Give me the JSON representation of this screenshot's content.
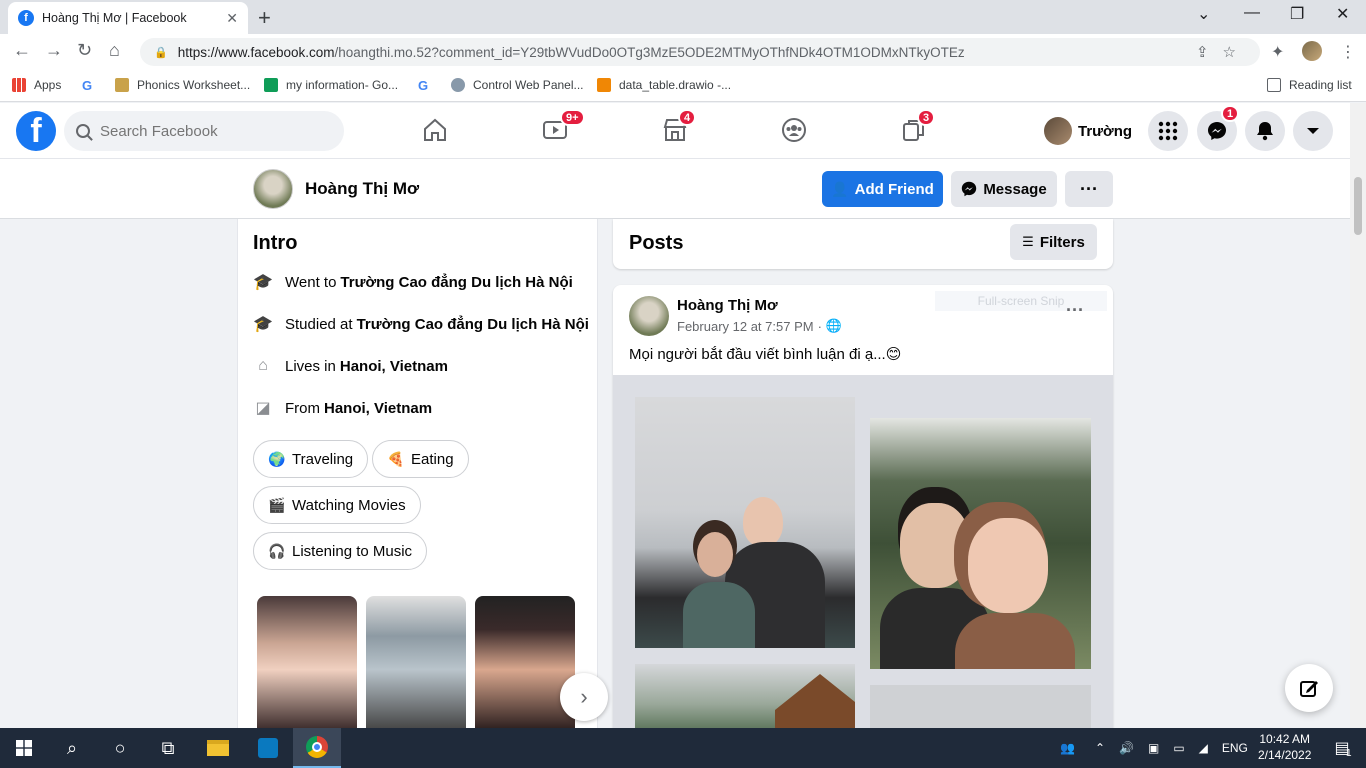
{
  "browser": {
    "tab_title": "Hoàng Thị Mơ | Facebook",
    "url_host": "https://www.facebook.com",
    "url_path": "/hoangthi.mo.52?comment_id=Y29tbWVudDo0OTg3MzE5ODE2MTMyOThfNDk4OTM1ODMxNTkyOTEz",
    "bookmarks": [
      {
        "label": "Apps"
      },
      {
        "label": ""
      },
      {
        "label": "Phonics Worksheet..."
      },
      {
        "label": "my information- Go..."
      },
      {
        "label": ""
      },
      {
        "label": "Control Web Panel..."
      },
      {
        "label": "data_table.drawio -..."
      }
    ],
    "reading_list": "Reading list"
  },
  "fb": {
    "search_placeholder": "Search Facebook",
    "watch_badge": "9+",
    "marketplace_badge": "4",
    "gaming_badge": "3",
    "user_name": "Trường",
    "messenger_badge": "1"
  },
  "profile": {
    "name": "Hoàng Thị Mơ",
    "add_friend": "Add Friend",
    "message": "Message",
    "more": "···"
  },
  "intro": {
    "title": "Intro",
    "rows": [
      {
        "prefix": "Went to",
        "value": "Trường Cao đẳng Du lịch Hà Nội",
        "icon": "graduation-cap-icon"
      },
      {
        "prefix": "Studied at",
        "value": "Trường Cao đẳng Du lịch Hà Nội",
        "icon": "graduation-cap-icon"
      },
      {
        "prefix": "Lives in",
        "value": "Hanoi, Vietnam",
        "icon": "home-icon"
      },
      {
        "prefix": "From",
        "value": "Hanoi, Vietnam",
        "icon": "location-icon"
      }
    ],
    "hobbies": [
      "Traveling",
      "Eating",
      "Watching Movies",
      "Listening to Music"
    ]
  },
  "posts": {
    "title": "Posts",
    "filters": "Filters",
    "post": {
      "author": "Hoàng Thị Mơ",
      "date": "February 12 at 7:57 PM",
      "date_sep": "·",
      "text": "Mọi người bắt đầu viết bình luận  đi ạ...😊",
      "overlay": "Full-screen Snip"
    }
  },
  "taskbar": {
    "lang": "ENG",
    "time": "10:42 AM",
    "date": "2/14/2022",
    "notif_count": "1"
  },
  "colors": {
    "fb_blue": "#1877f2",
    "badge_red": "#e41e3f",
    "bg": "#f0f2f5"
  }
}
